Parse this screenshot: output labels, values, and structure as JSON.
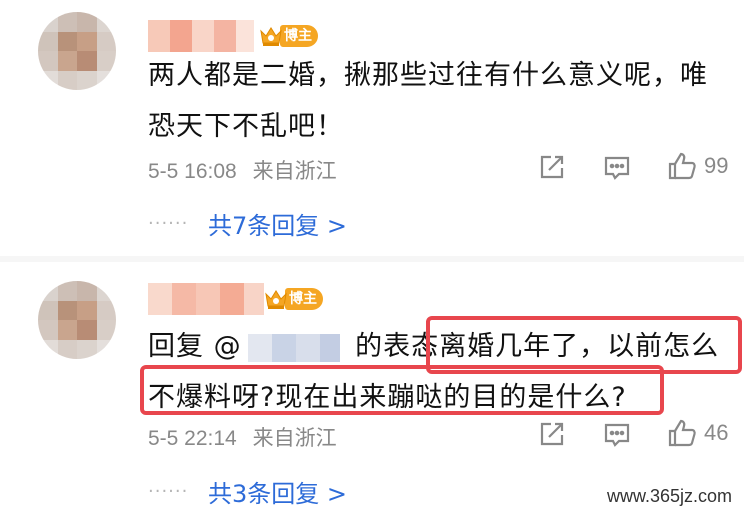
{
  "comments": [
    {
      "badge_label": "博主",
      "text_line1": "两人都是二婚，揪那些过往有什么意义呢，唯",
      "text_line2": "恐天下不乱吧！",
      "date": "5-5 16:08",
      "location": "来自浙江",
      "like_count": "99",
      "replies_label": "共7条回复 >"
    },
    {
      "badge_label": "博主",
      "reply_prefix": "回复 @",
      "reply_suffix": " 的表态",
      "text_line1_highlight": "离婚几年了，以前怎么",
      "text_line2_highlight": "不爆料呀?现在出来蹦哒的目的是什么?",
      "date": "5-5 22:14",
      "location": "来自浙江",
      "like_count": "46",
      "replies_label": "共3条回复 >"
    }
  ],
  "watermark": "www.365jz.com",
  "colors": {
    "link": "#2d6bd8",
    "badge": "#f5a623",
    "highlight": "#e8464d",
    "meta": "#888888"
  },
  "icons": [
    "share-icon",
    "comment-icon",
    "like-icon",
    "crown-icon"
  ]
}
